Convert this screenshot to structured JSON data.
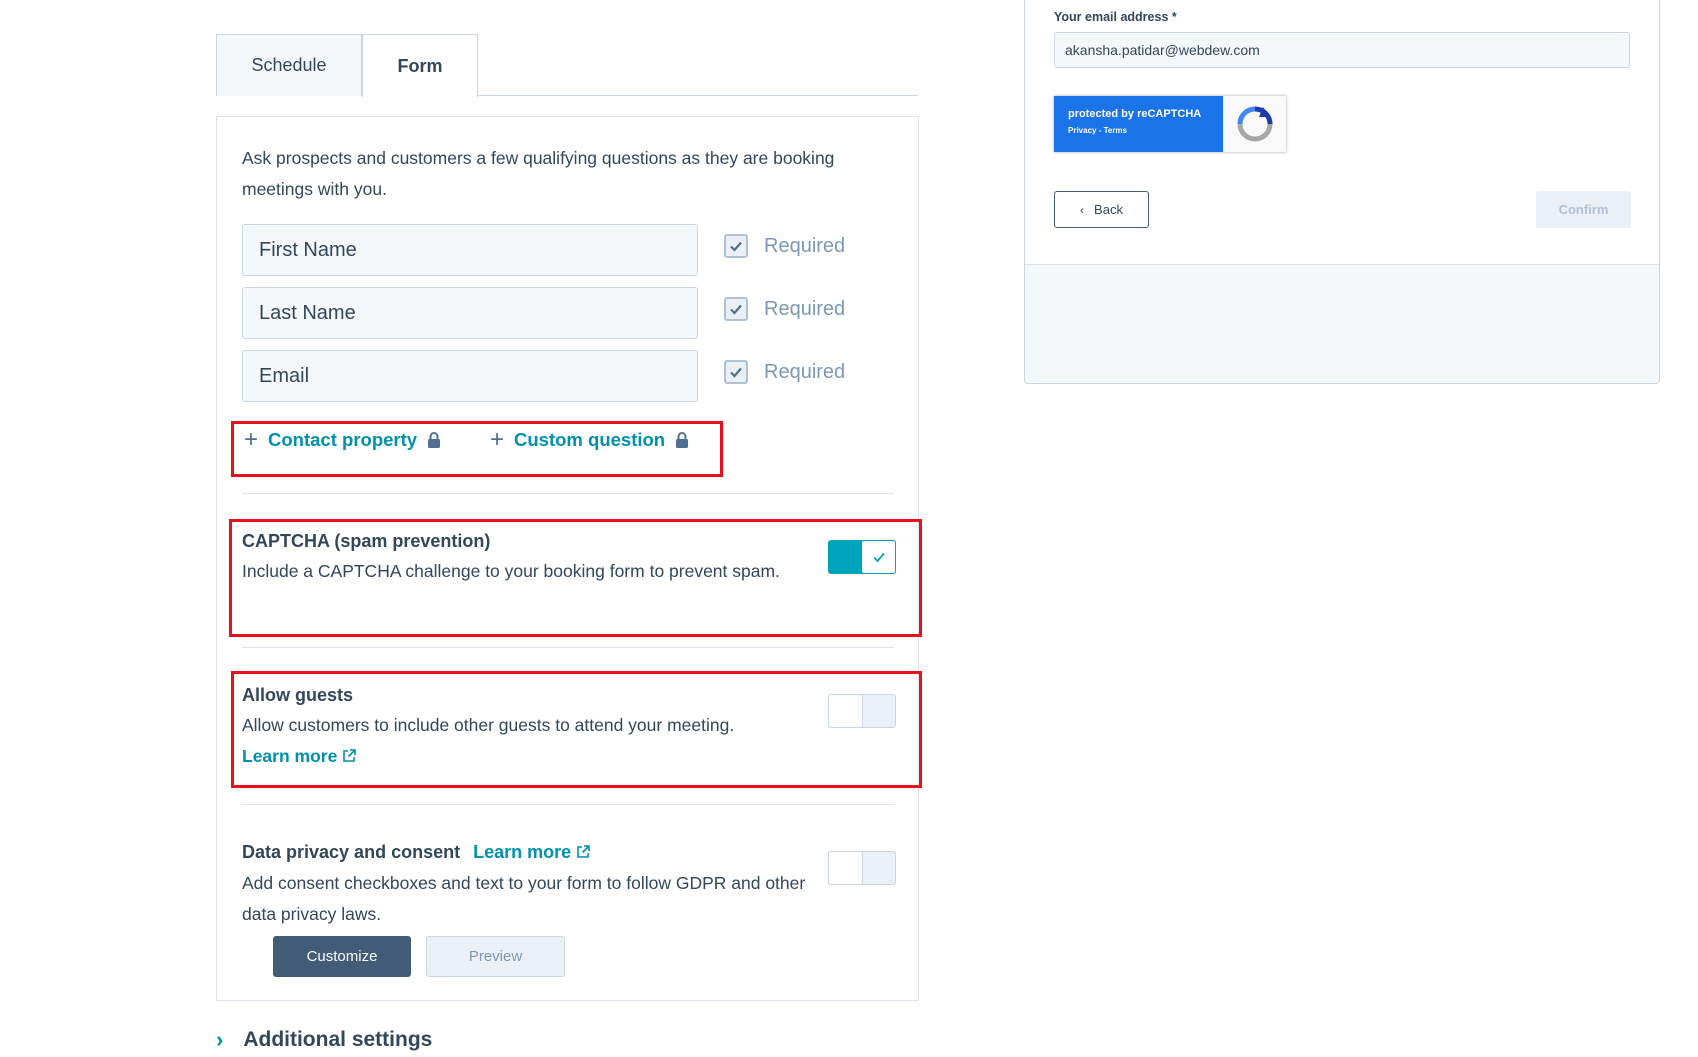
{
  "tabs": [
    {
      "label": "Schedule",
      "active": false
    },
    {
      "label": "Form",
      "active": true
    }
  ],
  "form": {
    "intro": "Ask prospects and customers a few qualifying questions as they are booking meetings with you.",
    "fields": [
      {
        "label": "First Name",
        "required_label": "Required",
        "required": true
      },
      {
        "label": "Last Name",
        "required_label": "Required",
        "required": true
      },
      {
        "label": "Email",
        "required_label": "Required",
        "required": true
      }
    ],
    "add_contact_property": "Contact property",
    "add_custom_question": "Custom question",
    "captcha": {
      "title": "CAPTCHA (spam prevention)",
      "desc": "Include a CAPTCHA challenge to your booking form to prevent spam.",
      "enabled": true
    },
    "guests": {
      "title": "Allow guests",
      "desc": "Allow customers to include other guests to attend your meeting.",
      "link": "Learn more",
      "enabled": false
    },
    "privacy": {
      "title": "Data privacy and consent",
      "link": "Learn more",
      "desc": "Add consent checkboxes and text to your form to follow GDPR and other data privacy laws.",
      "enabled": false,
      "customize_label": "Customize",
      "preview_label": "Preview"
    },
    "additional_settings": "Additional settings"
  },
  "preview_panel": {
    "email_label": "Your email address *",
    "email_value": "akansha.patidar@webdew.com",
    "recaptcha_line1": "protected by reCAPTCHA",
    "recaptcha_line2": "Privacy - Terms",
    "back_label": "Back",
    "confirm_label": "Confirm"
  },
  "colors": {
    "accent": "#0091ae",
    "toggle_on": "#00a4bd",
    "primary_button": "#425b76",
    "highlight_box": "#e8101a",
    "recaptcha_blue": "#1a73e8"
  }
}
